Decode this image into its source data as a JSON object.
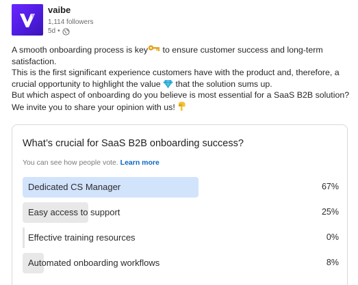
{
  "post": {
    "author": "vaibe",
    "followers": "1,114 followers",
    "time": "5d",
    "separator": "•",
    "visibility_icon": "globe-icon"
  },
  "body": {
    "p1_a": "A smooth onboarding process is key",
    "p1_b": " to ensure customer success and long-term satisfaction.",
    "p2_a": "This is the first significant experience customers have with the product and, therefore, a crucial opportunity to highlight the value ",
    "p2_b": " that the solution sums up.",
    "p3": "But which aspect of onboarding do you believe is most essential for a SaaS B2B solution? We invite you to share your opinion with us! ",
    "icons": [
      "key-icon",
      "gem-icon",
      "pointing-down-icon"
    ]
  },
  "poll": {
    "question": "What’s crucial for SaaS B2B onboarding success?",
    "note": "You can see how people vote.",
    "learn_more": "Learn more",
    "options": [
      {
        "label": "Dedicated CS Manager",
        "percent": "67%",
        "value": 0.67,
        "selected": true
      },
      {
        "label": "Easy access to support",
        "percent": "25%",
        "value": 0.25,
        "selected": false
      },
      {
        "label": "Effective training resources",
        "percent": "0%",
        "value": 0.0,
        "selected": false
      },
      {
        "label": "Automated onboarding workflows",
        "percent": "8%",
        "value": 0.08,
        "selected": false
      }
    ]
  },
  "colors": {
    "brand_purple": "#5a21ef",
    "selected_bar": "#d2e3fc",
    "bar": "#e8e8e8",
    "link": "#0a66c2"
  }
}
